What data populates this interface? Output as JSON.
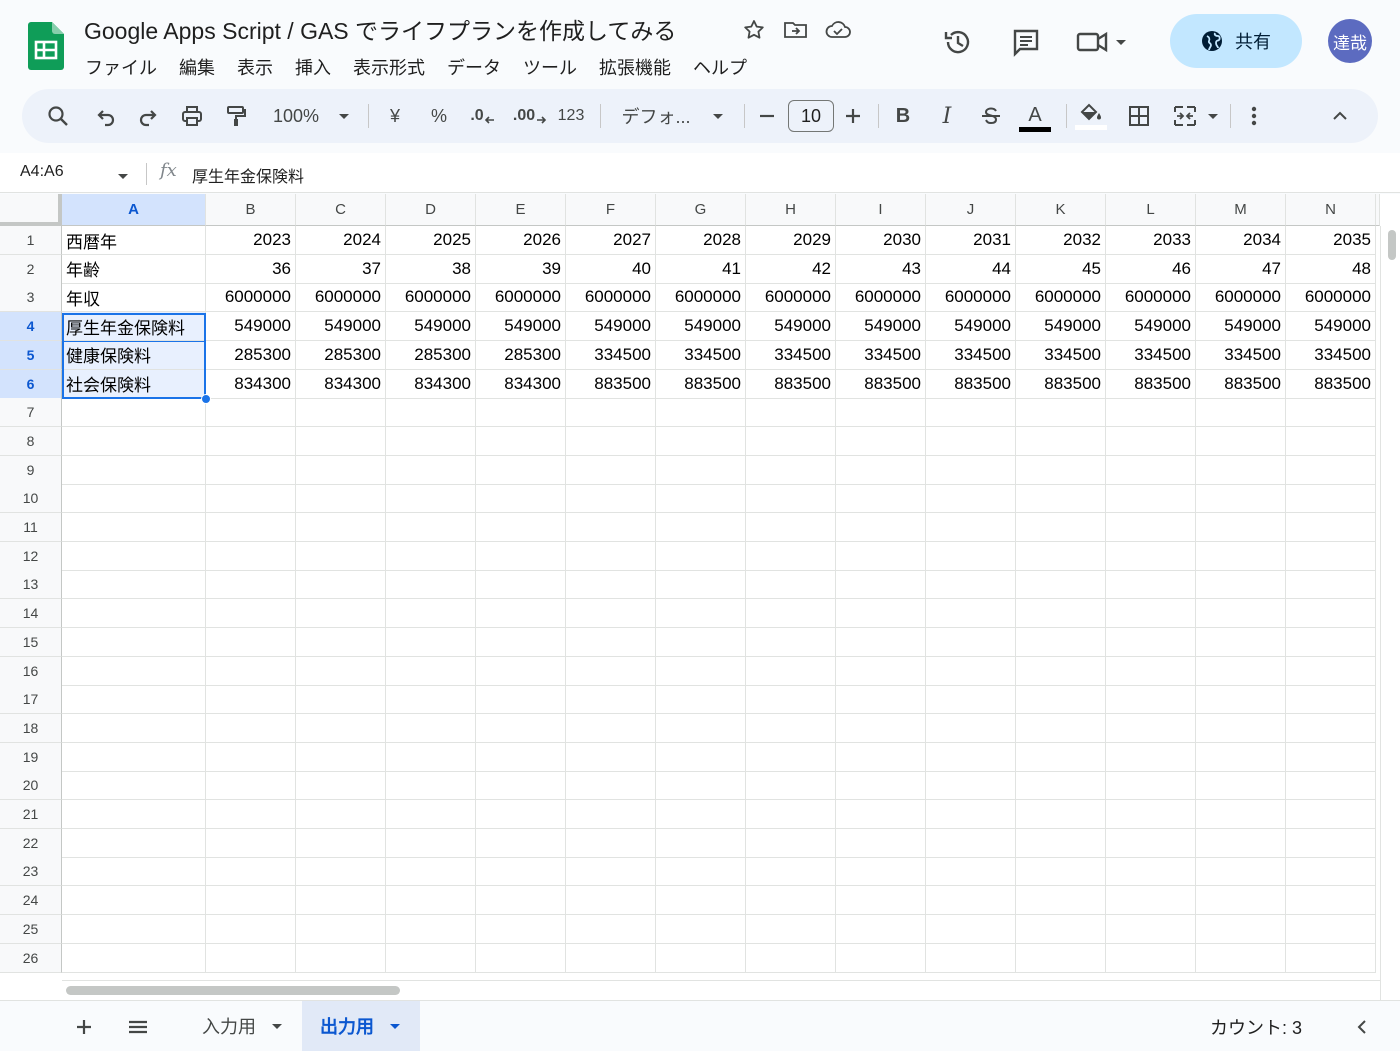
{
  "doc": {
    "title": "Google Apps Script / GAS でライフプランを作成してみる"
  },
  "menu": [
    "ファイル",
    "編集",
    "表示",
    "挿入",
    "表示形式",
    "データ",
    "ツール",
    "拡張機能",
    "ヘルプ"
  ],
  "share": {
    "label": "共有"
  },
  "user": {
    "initials": "達哉"
  },
  "toolbar": {
    "zoom": "100%",
    "currency": "¥",
    "percent": "%",
    "dec_decrease": ".0",
    "dec_increase": ".00",
    "number_format": "123",
    "font": "デフォ...",
    "font_size": "10",
    "bold": "B",
    "italic": "I",
    "text_color": "A"
  },
  "formula_bar": {
    "name_box": "A4:A6",
    "fx": "fx",
    "content": "厚生年金保険料"
  },
  "columns": [
    "A",
    "B",
    "C",
    "D",
    "E",
    "F",
    "G",
    "H",
    "I",
    "J",
    "K",
    "L",
    "M",
    "N"
  ],
  "rows": [
    "1",
    "2",
    "3",
    "4",
    "5",
    "6",
    "7",
    "8",
    "9",
    "10",
    "11",
    "12",
    "13",
    "14",
    "15",
    "16",
    "17",
    "18",
    "19",
    "20",
    "21",
    "22",
    "23",
    "24",
    "25",
    "26"
  ],
  "cells": [
    [
      "西暦年",
      "2023",
      "2024",
      "2025",
      "2026",
      "2027",
      "2028",
      "2029",
      "2030",
      "2031",
      "2032",
      "2033",
      "2034",
      "2035"
    ],
    [
      "年齢",
      "36",
      "37",
      "38",
      "39",
      "40",
      "41",
      "42",
      "43",
      "44",
      "45",
      "46",
      "47",
      "48"
    ],
    [
      "年収",
      "6000000",
      "6000000",
      "6000000",
      "6000000",
      "6000000",
      "6000000",
      "6000000",
      "6000000",
      "6000000",
      "6000000",
      "6000000",
      "6000000",
      "6000000"
    ],
    [
      "厚生年金保険料",
      "549000",
      "549000",
      "549000",
      "549000",
      "549000",
      "549000",
      "549000",
      "549000",
      "549000",
      "549000",
      "549000",
      "549000",
      "549000"
    ],
    [
      "健康保険料",
      "285300",
      "285300",
      "285300",
      "285300",
      "334500",
      "334500",
      "334500",
      "334500",
      "334500",
      "334500",
      "334500",
      "334500",
      "334500"
    ],
    [
      "社会保険料",
      "834300",
      "834300",
      "834300",
      "834300",
      "883500",
      "883500",
      "883500",
      "883500",
      "883500",
      "883500",
      "883500",
      "883500",
      "883500"
    ]
  ],
  "sheets": [
    {
      "name": "入力用",
      "active": false
    },
    {
      "name": "出力用",
      "active": true
    }
  ],
  "status": {
    "count": "カウント: 3"
  }
}
